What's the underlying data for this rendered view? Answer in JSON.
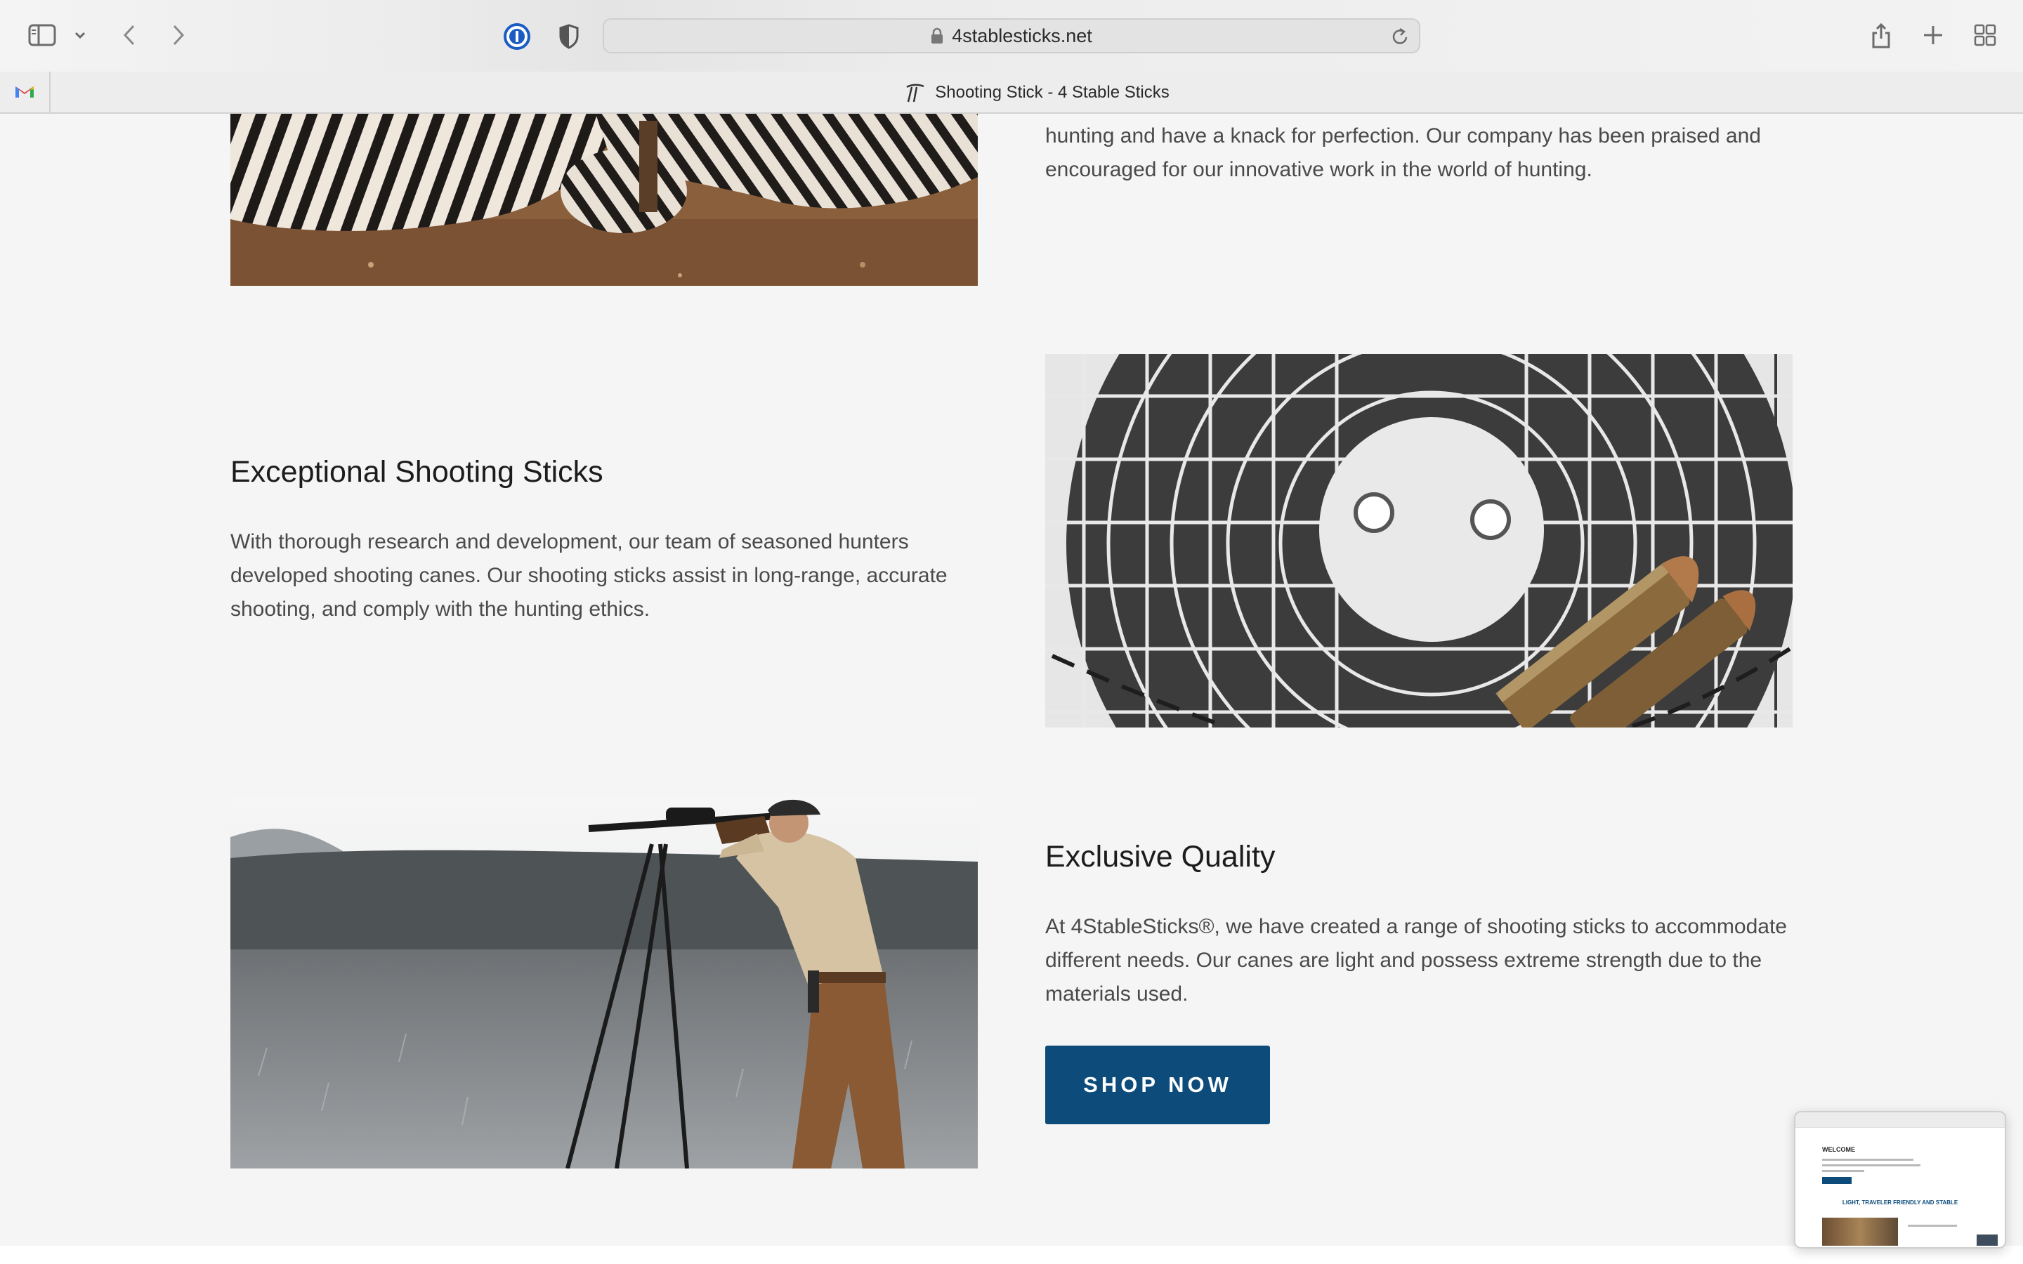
{
  "browser": {
    "url": "4stablesticks.net",
    "tab_title": "Shooting Stick - 4 Stable Sticks",
    "icons": {
      "sidebar": "sidebar-icon",
      "sidebar_menu": "chevron-down-icon",
      "back": "chevron-left-icon",
      "forward": "chevron-right-icon",
      "password_manager": "1password-icon",
      "privacy": "shield-icon",
      "lock": "lock-icon",
      "reload": "reload-icon",
      "share": "share-icon",
      "new_tab": "plus-icon",
      "tab_overview": "grid-icon",
      "pinned_tab": "gmail-icon"
    }
  },
  "sections": {
    "intro": {
      "text_line1": "hunting and have a knack for perfection. Our company has been praised and",
      "text_line2": "encouraged for our innovative work in the world of hunting."
    },
    "exceptional": {
      "heading": "Exceptional Shooting Sticks",
      "line1": "With thorough research and development, our team of seasoned hunters",
      "line2": "developed shooting canes. Our shooting sticks assist in long-range, accurate",
      "line3": "shooting, and comply with the hunting ethics."
    },
    "exclusive": {
      "heading": "Exclusive Quality",
      "line1": "At 4StableSticks®, we have created a range of shooting sticks to accommodate",
      "line2": "different needs. Our canes are light and possess extreme strength due to the",
      "line3": "materials used.",
      "button": "SHOP NOW"
    }
  },
  "preview": {
    "title": "WELCOME",
    "heading": "LIGHT, TRAVELER FRIENDLY AND STABLE"
  },
  "colors": {
    "accent": "#0d4c7a",
    "page_bg": "#f5f5f5",
    "text": "#4a4a4a",
    "heading": "#1c1c1c"
  }
}
